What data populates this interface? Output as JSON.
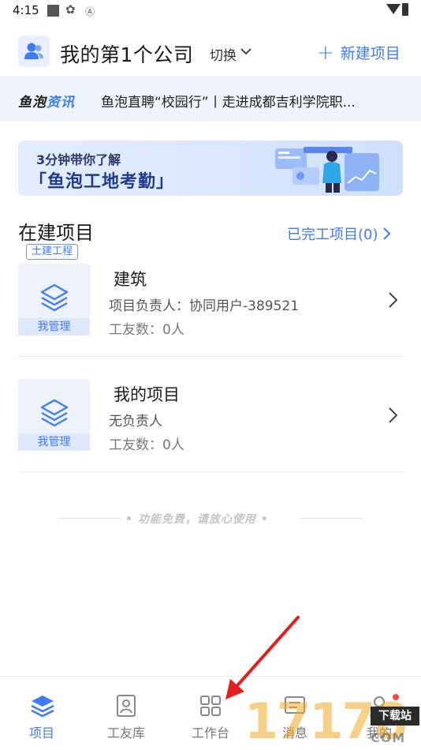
{
  "status_bar": {
    "time": "4:15"
  },
  "header": {
    "company_name": "我的第1个公司",
    "switch_label": "切换",
    "new_project_label": "新建项目"
  },
  "news": {
    "logo_part1": "鱼泡",
    "logo_part2": "资讯",
    "headline": "鱼泡直聘“校园行”丨走进成都吉利学院职..."
  },
  "banner": {
    "line1": "3分钟带你了解",
    "line2": "「鱼泡工地考勤」"
  },
  "section": {
    "title": "在建项目",
    "completed_link": "已完工项目(0)"
  },
  "projects": [
    {
      "tag": "土建工程",
      "name": "建筑",
      "lead": "项目负责人：协同用户-389521",
      "workers": "工友数：0人",
      "manage_label": "我管理"
    },
    {
      "tag": "",
      "name": "我的项目",
      "lead": "无负责人",
      "workers": "工友数：0人",
      "manage_label": "我管理"
    }
  ],
  "free_note": "• 功能免费，请放心使用 •",
  "bottom_nav": [
    {
      "label": "项目",
      "icon": "layers-icon",
      "active": true
    },
    {
      "label": "工友库",
      "icon": "contact-card-icon",
      "active": false
    },
    {
      "label": "工作台",
      "icon": "grid-icon",
      "active": false
    },
    {
      "label": "消息",
      "icon": "message-icon",
      "active": false
    },
    {
      "label": "我的",
      "icon": "person-icon",
      "active": false
    }
  ],
  "watermark": {
    "number": "17178",
    "tag": "下载站",
    "domain": "COM"
  },
  "colors": {
    "accent": "#3f7cf4",
    "news_bg": "#eef3fc",
    "badge": "#f04a3e",
    "annotation_arrow": "#e02020"
  }
}
